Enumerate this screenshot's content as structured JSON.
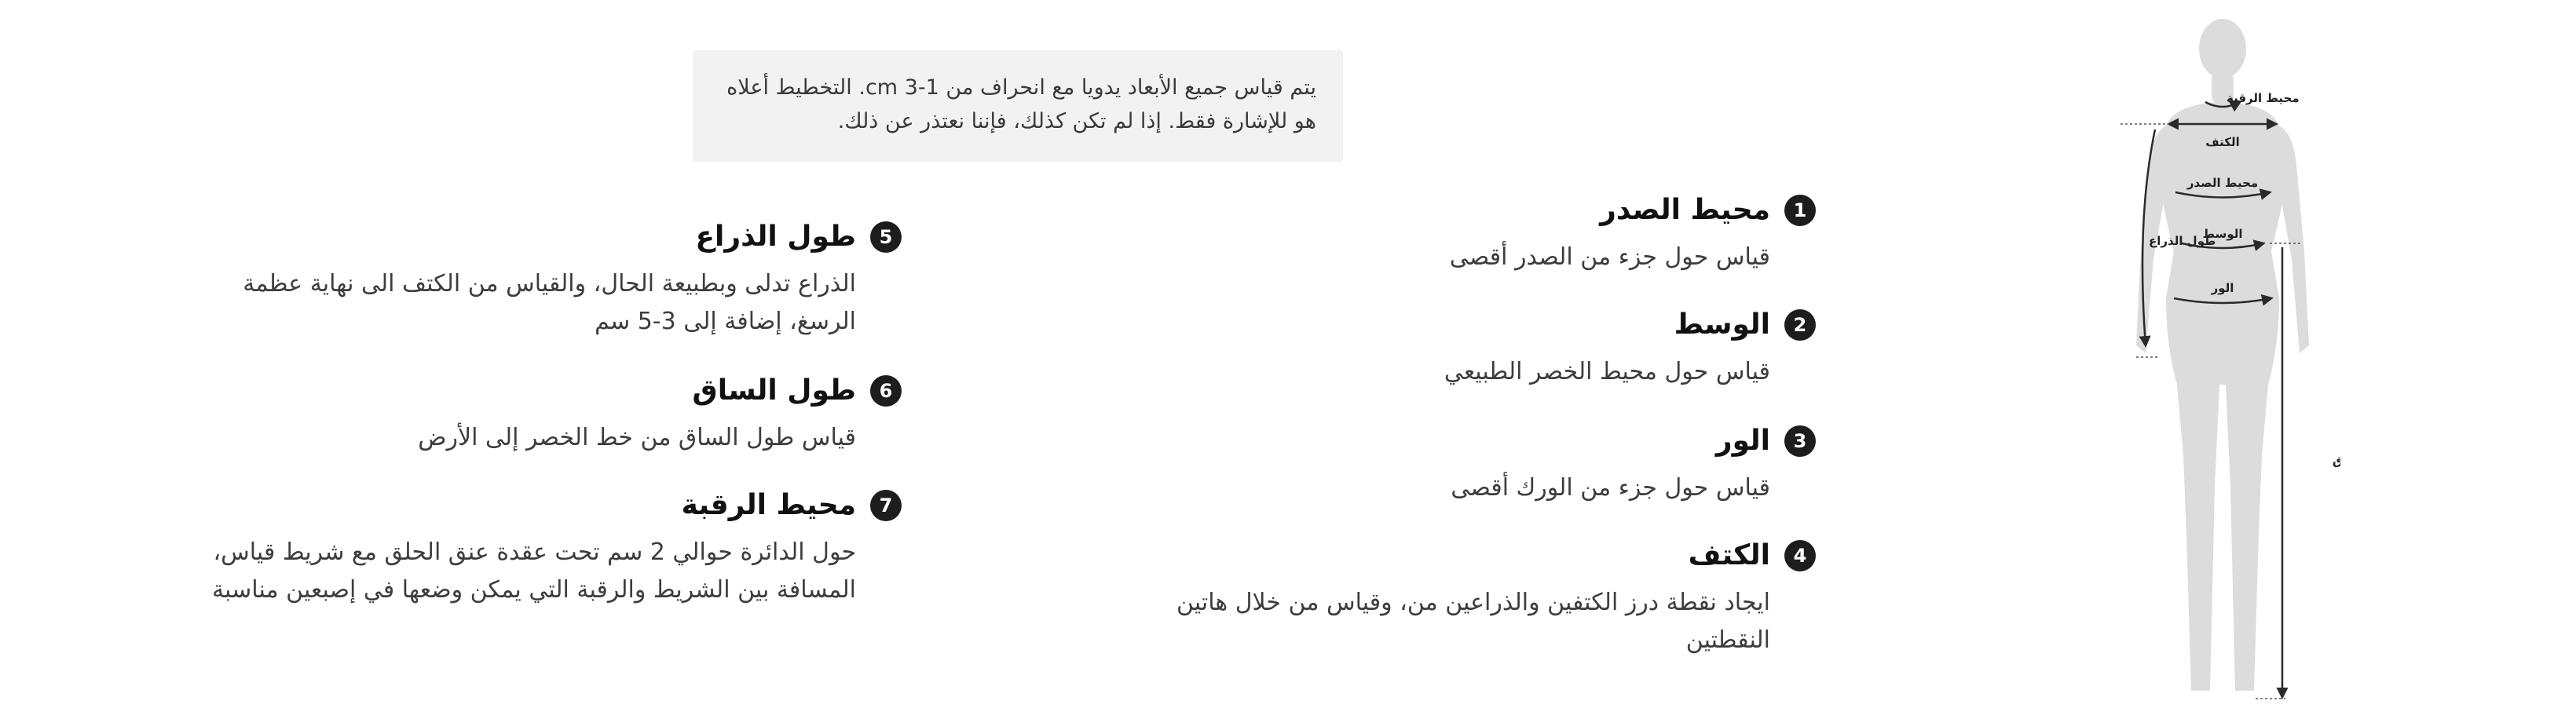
{
  "note": {
    "line1": "يتم قياس جميع الأبعاد يدويا مع انحراف من 1-3 cm. التخطيط أعلاه",
    "line2": "هو للإشارة فقط. إذا لم تكن كذلك، فإننا نعتذر عن ذلك."
  },
  "items": [
    {
      "num": "1",
      "title": "محيط الصدر",
      "desc": "قياس حول جزء من الصدر أقصى"
    },
    {
      "num": "2",
      "title": "الوسط",
      "desc": "قياس حول محيط الخصر الطبيعي"
    },
    {
      "num": "3",
      "title": "الور",
      "desc": "قياس حول جزء من الورك أقصى"
    },
    {
      "num": "4",
      "title": "الكتف",
      "desc_line1": "ايجاد نقطة درز الكتفين والذراعين من، وقياس من خلال هاتين",
      "desc_line2": "النقطتين"
    },
    {
      "num": "5",
      "title": "طول الذراع",
      "desc_line1": "الذراع تدلى وبطبيعة الحال، والقياس من الكتف الى نهاية عظمة",
      "desc_line2": "الرسغ، إضافة إلى 3-5 سم"
    },
    {
      "num": "6",
      "title": "طول الساق",
      "desc": "قياس طول الساق من خط الخصر إلى الأرض"
    },
    {
      "num": "7",
      "title": "محيط الرقبة",
      "desc_line1": "حول الدائرة حوالي 2 سم تحت عقدة عنق الحلق مع شريط قياس،",
      "desc_line2": "المسافة بين الشريط والرقبة التي يمكن وضعها في إصبعين مناسبة"
    }
  ],
  "figure": {
    "labels": {
      "neck": "محيط الرقبة",
      "shoulder": "الكتف",
      "chest": "محيط الصدر",
      "waist": "الوسط",
      "hip": "الور",
      "arm": "طول الذراع",
      "leg": "طول الساق"
    },
    "colors": {
      "body": "#dcdcdc",
      "line": "#2a2a2a"
    }
  }
}
